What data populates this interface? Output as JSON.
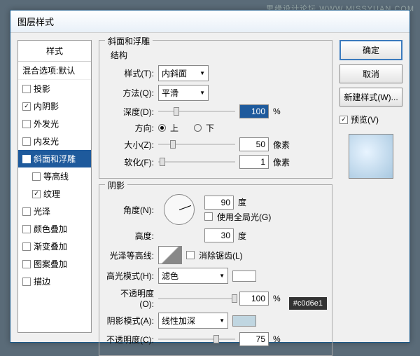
{
  "watermark": "思缘设计论坛  WWW.MISSYUAN.COM",
  "dialog": {
    "title": "图层样式"
  },
  "styles": {
    "header": "样式",
    "defaults": "混合选项:默认",
    "items": [
      {
        "label": "投影",
        "checked": false
      },
      {
        "label": "内阴影",
        "checked": true
      },
      {
        "label": "外发光",
        "checked": false
      },
      {
        "label": "内发光",
        "checked": false
      },
      {
        "label": "斜面和浮雕",
        "checked": true,
        "selected": true
      },
      {
        "label": "等高线",
        "checked": false,
        "sub": true
      },
      {
        "label": "纹理",
        "checked": true,
        "sub": true
      },
      {
        "label": "光泽",
        "checked": false
      },
      {
        "label": "颜色叠加",
        "checked": false
      },
      {
        "label": "渐变叠加",
        "checked": false
      },
      {
        "label": "图案叠加",
        "checked": false
      },
      {
        "label": "描边",
        "checked": false
      }
    ]
  },
  "bevel": {
    "group_title": "斜面和浮雕",
    "structure_title": "结构",
    "style_label": "样式(T):",
    "style_value": "内斜面",
    "technique_label": "方法(Q):",
    "technique_value": "平滑",
    "depth_label": "深度(D):",
    "depth_value": "100",
    "percent": "%",
    "direction_label": "方向:",
    "up": "上",
    "down": "下",
    "size_label": "大小(Z):",
    "size_value": "50",
    "px": "像素",
    "soften_label": "软化(F):",
    "soften_value": "1"
  },
  "shading": {
    "title": "阴影",
    "angle_label": "角度(N):",
    "angle_value": "90",
    "degree": "度",
    "global_label": "使用全局光(G)",
    "altitude_label": "高度:",
    "altitude_value": "30",
    "gloss_label": "光泽等高线:",
    "antialias_label": "消除锯齿(L)",
    "hmode_label": "高光模式(H):",
    "hmode_value": "滤色",
    "hopac_label": "不透明度(O):",
    "hopac_value": "100",
    "smode_label": "阴影模式(A):",
    "smode_value": "线性加深",
    "sopac_label": "不透明度(C):",
    "sopac_value": "75"
  },
  "buttons": {
    "ok": "确定",
    "cancel": "取消",
    "new_style": "新建样式(W)...",
    "preview": "预览(V)"
  },
  "tooltip": "#c0d6e1"
}
